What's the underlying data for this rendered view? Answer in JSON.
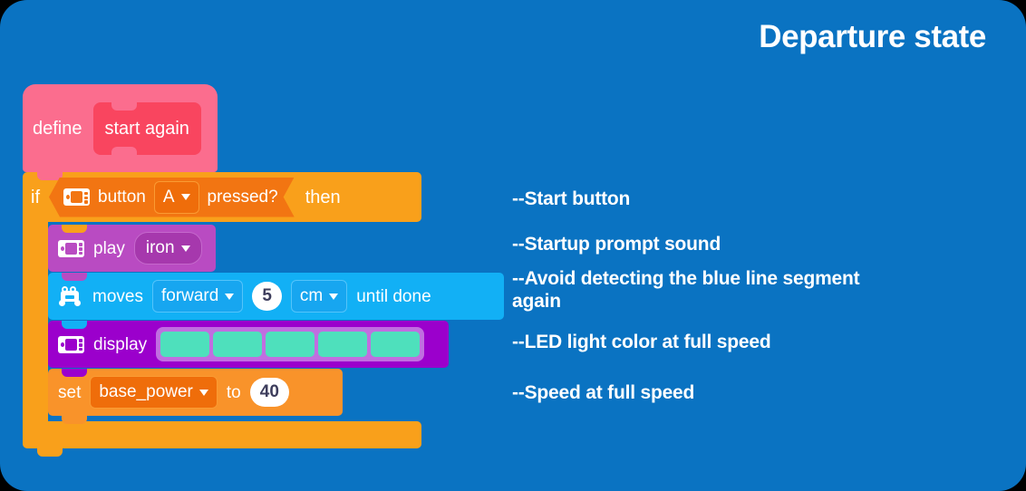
{
  "page": {
    "background_color": "#0a73c2",
    "title": "Departure state"
  },
  "blocks": {
    "define": {
      "keyword": "define",
      "function_name": "start again",
      "color": "#fb6d8e",
      "inner_color": "#f9455f"
    },
    "if_block": {
      "if_label": "if",
      "then_label": "then",
      "color": "#f9a01b",
      "condition": {
        "icon": "microbit-board-icon",
        "label": "button",
        "dropdown_value": "A",
        "suffix": "pressed?",
        "color": "#f27512"
      }
    },
    "statements": [
      {
        "id": "play",
        "icon": "microbit-board-icon",
        "label": "play",
        "dropdown_value": "iron",
        "color": "#b94bc2"
      },
      {
        "id": "moves",
        "icon": "robot-car-icon",
        "label": "moves",
        "direction": "forward",
        "amount": "5",
        "unit": "cm",
        "suffix": "until done",
        "color": "#12b0f5"
      },
      {
        "id": "display",
        "icon": "microbit-board-icon",
        "label": "display",
        "led_colors": [
          "#4ee0bc",
          "#4ee0bc",
          "#4ee0bc",
          "#4ee0bc",
          "#4ee0bc"
        ],
        "color": "#9b00cc"
      },
      {
        "id": "set",
        "label": "set",
        "variable": "base_power",
        "to_label": "to",
        "value": "40",
        "color": "#f9932a"
      }
    ]
  },
  "annotations": [
    "--Start button",
    "--Startup prompt sound",
    "--Avoid detecting the blue line segment again",
    "--LED light color at full speed",
    "--Speed at full speed"
  ]
}
